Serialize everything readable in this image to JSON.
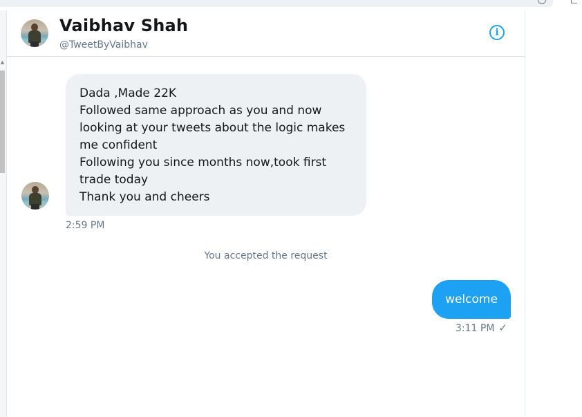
{
  "conversation": {
    "name": "Vaibhav Shah",
    "handle": "@TweetByVaibhav",
    "info_icon": "info-icon"
  },
  "messages": {
    "incoming": {
      "lines": [
        "Dada ,Made 22K",
        "Followed same approach as you and now",
        "looking at your tweets about the logic makes",
        "me confident",
        "Following you since months now,took first",
        "trade today",
        "Thank you and cheers"
      ],
      "time": "2:59 PM"
    },
    "system_note": "You accepted the request",
    "outgoing": {
      "text": "welcome",
      "time": "3:11 PM",
      "status_icon": "checkmark-icon",
      "status_glyph": "✓"
    }
  },
  "colors": {
    "accent": "#1da1f2",
    "incoming_bubble": "#eef1f3",
    "muted_text": "#657786"
  }
}
